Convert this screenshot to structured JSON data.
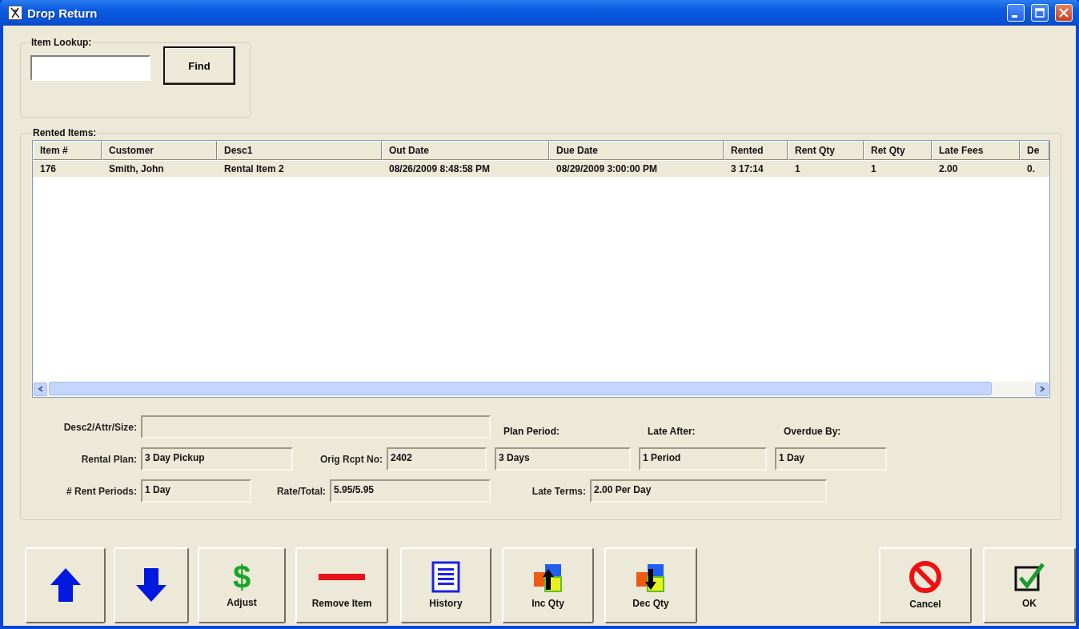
{
  "window": {
    "title": "Drop Return"
  },
  "item_lookup": {
    "legend": "Item Lookup:",
    "find_button": "Find"
  },
  "rented_items": {
    "legend": "Rented Items:",
    "columns": [
      "Item #",
      "Customer",
      "Desc1",
      "Out Date",
      "Due Date",
      "Rented",
      "Rent Qty",
      "Ret Qty",
      "Late Fees",
      "De"
    ],
    "rows": [
      {
        "selected": true,
        "cells": [
          "176",
          "Smith, John",
          "Rental Item 2",
          "08/26/2009 8:48:58 PM",
          "08/29/2009 3:00:00 PM",
          "3 17:14",
          "1",
          "1",
          "2.00",
          "0."
        ]
      }
    ]
  },
  "details": {
    "desc2": {
      "label": "Desc2/Attr/Size:"
    },
    "rental_plan": {
      "label": "Rental Plan:",
      "value": "3 Day Pickup"
    },
    "orig_rcpt_no": {
      "label": "Orig Rcpt No:",
      "value": "2402"
    },
    "rent_periods": {
      "label": "# Rent Periods:",
      "value": "1 Day"
    },
    "rate_total": {
      "label": "Rate/Total:",
      "value": "5.95/5.95"
    },
    "plan_period": {
      "label": "Plan Period:",
      "value": "3 Days"
    },
    "late_after": {
      "label": "Late After:",
      "value": "1 Period"
    },
    "overdue_by": {
      "label": "Overdue By:",
      "value": "1 Day"
    },
    "late_terms": {
      "label": "Late Terms:",
      "value": "2.00 Per Day"
    }
  },
  "buttons": [
    {
      "kind": "up"
    },
    {
      "kind": "down"
    },
    {
      "kind": "adjust",
      "glyph": "$",
      "label": "Adjust"
    },
    {
      "kind": "remove",
      "label": "Remove Item"
    },
    {
      "kind": "history",
      "label": "History"
    },
    {
      "kind": "inc",
      "label": "Inc Qty"
    },
    {
      "kind": "dec",
      "label": "Dec Qty"
    },
    {
      "kind": "cancel",
      "label": "Cancel"
    },
    {
      "kind": "ok",
      "label": "OK"
    }
  ]
}
